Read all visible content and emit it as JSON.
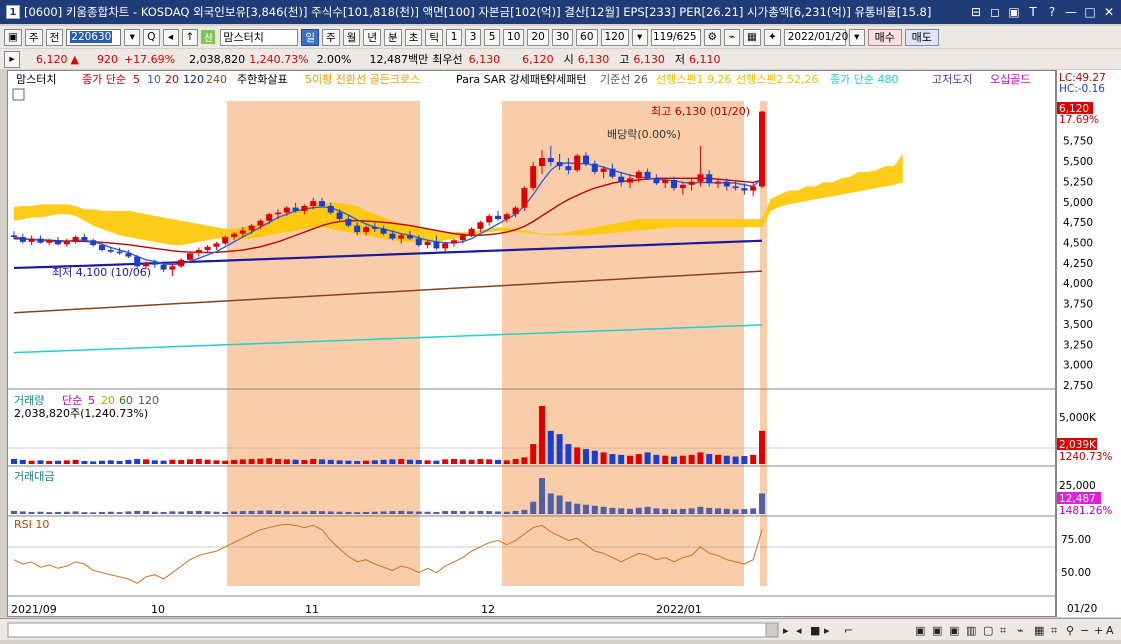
{
  "window": {
    "number": "1",
    "title": "[0600] 키움종합차트 - KOSDAQ 외국인보유[3,846(천)] 주식수[101,818(천)] 액면[100] 자본금[102(억)] 결산[12월] EPS[233] PER[26.21] 시가총액[6,231(억)] 유통비율[15.8]",
    "controls": [
      "⊟",
      "◻",
      "▣",
      "T",
      "?",
      "—",
      "□",
      "✕"
    ]
  },
  "toolbar1": {
    "tab_stock": "주",
    "tab_prev": "전",
    "code": "220630",
    "search_icon": "Q",
    "sound_icon": "◂",
    "indicator_group_num": "신",
    "indicator_name": "맘스터치",
    "periods": [
      "일",
      "주",
      "월",
      "년",
      "분",
      "초",
      "틱"
    ],
    "minutes": [
      "1",
      "3",
      "5",
      "10",
      "20",
      "30",
      "60",
      "120"
    ],
    "counter": "119/625",
    "date": "2022/01/20",
    "buy": "매수",
    "sell": "매도"
  },
  "quote": {
    "price": "6,120",
    "up_arrow": "▲",
    "change": "920",
    "change_pct": "+17.69%",
    "volume": "2,038,820",
    "volume_pct": "1,240.73%",
    "turnover": "2.00%",
    "amount": "12,487백만",
    "best_ask_label": "최우선",
    "best_ask": "6,130",
    "best_bid": "6,120",
    "open_label": "시",
    "open": "6,130",
    "high_label": "고",
    "high": "6,130",
    "low_label": "저",
    "low": "6,110"
  },
  "legend": {
    "name": "맘스터치",
    "ma_label": "종가 단순",
    "ma": [
      "5",
      "10",
      "20",
      "120",
      "240"
    ],
    "signal_label": "주한화살표",
    "pattern1": "5이평 전환선 골든크로스",
    "pattern2": "Para SAR 강세패턴",
    "pattern3": "약세패턴",
    "kijun": "기준선 26",
    "span1": "선행스팬1 9,26",
    "span2": "선행스팬2 52,26",
    "ma480": "종가 단순 480",
    "highlow": "고저도지",
    "goldcross": "오십골드"
  },
  "annotations": {
    "high": "최고 6,130 (01/20)",
    "low": "최저 4,100 (10/06)",
    "dividend": "배당락(0.00%)"
  },
  "price_axis": {
    "labels": [
      "5,750",
      "5,500",
      "5,250",
      "5,000",
      "4,750",
      "4,500",
      "4,250",
      "4,000",
      "3,750",
      "3,500",
      "3,250",
      "3,000",
      "2,750"
    ],
    "lc": "LC:49.27",
    "hc": "HC:-0.16",
    "curr_price": "6,120",
    "curr_pct": "17.69%"
  },
  "volume_panel": {
    "title": "거래량",
    "ma_label": "단순",
    "ma": [
      "5",
      "20",
      "60",
      "120"
    ],
    "info": "2,038,820주(1,240.73%)",
    "axis_label": "5,000K",
    "curr": "2,039K",
    "curr_pct": "1240.73%"
  },
  "amount_panel": {
    "title": "거래대금",
    "axis_label": "25,000",
    "curr": "12,487",
    "curr_pct": "1481.26%"
  },
  "rsi_panel": {
    "title": "RSI 10",
    "labels": [
      "75.00",
      "50.00"
    ]
  },
  "x_axis": {
    "labels": [
      "2021/09",
      "10",
      "11",
      "12",
      "2022/01"
    ],
    "axis_date": "01/20"
  },
  "chart_data": {
    "type": "candlestick",
    "ylim": [
      2750,
      6250
    ],
    "candles": [
      [
        4600,
        4650,
        4550,
        4580
      ],
      [
        4580,
        4620,
        4500,
        4520
      ],
      [
        4520,
        4600,
        4480,
        4560
      ],
      [
        4560,
        4600,
        4500,
        4510
      ],
      [
        4510,
        4560,
        4480,
        4540
      ],
      [
        4540,
        4580,
        4480,
        4490
      ],
      [
        4490,
        4560,
        4460,
        4530
      ],
      [
        4530,
        4600,
        4500,
        4580
      ],
      [
        4580,
        4620,
        4520,
        4540
      ],
      [
        4540,
        4560,
        4460,
        4480
      ],
      [
        4480,
        4520,
        4400,
        4420
      ],
      [
        4420,
        4460,
        4380,
        4400
      ],
      [
        4400,
        4450,
        4360,
        4380
      ],
      [
        4380,
        4420,
        4320,
        4340
      ],
      [
        4340,
        4360,
        4200,
        4220
      ],
      [
        4220,
        4280,
        4180,
        4260
      ],
      [
        4260,
        4300,
        4200,
        4240
      ],
      [
        4240,
        4280,
        4150,
        4180
      ],
      [
        4180,
        4260,
        4100,
        4220
      ],
      [
        4220,
        4320,
        4200,
        4300
      ],
      [
        4300,
        4400,
        4280,
        4380
      ],
      [
        4380,
        4450,
        4340,
        4420
      ],
      [
        4420,
        4480,
        4380,
        4460
      ],
      [
        4460,
        4520,
        4420,
        4500
      ],
      [
        4500,
        4600,
        4480,
        4580
      ],
      [
        4580,
        4640,
        4540,
        4620
      ],
      [
        4620,
        4700,
        4580,
        4660
      ],
      [
        4660,
        4740,
        4620,
        4720
      ],
      [
        4720,
        4800,
        4680,
        4780
      ],
      [
        4780,
        4880,
        4740,
        4860
      ],
      [
        4860,
        4920,
        4800,
        4880
      ],
      [
        4880,
        4960,
        4840,
        4940
      ],
      [
        4940,
        5000,
        4880,
        4900
      ],
      [
        4900,
        4980,
        4860,
        4960
      ],
      [
        4960,
        5060,
        4920,
        5020
      ],
      [
        5020,
        5060,
        4940,
        4960
      ],
      [
        4960,
        5000,
        4860,
        4880
      ],
      [
        4880,
        4920,
        4780,
        4800
      ],
      [
        4800,
        4840,
        4700,
        4720
      ],
      [
        4720,
        4760,
        4600,
        4640
      ],
      [
        4640,
        4720,
        4600,
        4700
      ],
      [
        4700,
        4760,
        4640,
        4680
      ],
      [
        4680,
        4720,
        4600,
        4620
      ],
      [
        4620,
        4660,
        4540,
        4560
      ],
      [
        4560,
        4620,
        4500,
        4600
      ],
      [
        4600,
        4660,
        4540,
        4560
      ],
      [
        4560,
        4600,
        4460,
        4480
      ],
      [
        4480,
        4540,
        4440,
        4520
      ],
      [
        4520,
        4600,
        4420,
        4440
      ],
      [
        4440,
        4520,
        4400,
        4500
      ],
      [
        4500,
        4560,
        4460,
        4540
      ],
      [
        4540,
        4620,
        4500,
        4600
      ],
      [
        4600,
        4700,
        4580,
        4680
      ],
      [
        4680,
        4780,
        4640,
        4760
      ],
      [
        4760,
        4860,
        4720,
        4840
      ],
      [
        4840,
        4900,
        4780,
        4800
      ],
      [
        4800,
        4880,
        4760,
        4860
      ],
      [
        4860,
        4960,
        4820,
        4940
      ],
      [
        4940,
        5200,
        4900,
        5180
      ],
      [
        5180,
        5500,
        5150,
        5450
      ],
      [
        5450,
        5650,
        5350,
        5550
      ],
      [
        5550,
        5700,
        5450,
        5500
      ],
      [
        5500,
        5600,
        5400,
        5450
      ],
      [
        5450,
        5550,
        5350,
        5400
      ],
      [
        5400,
        5600,
        5380,
        5580
      ],
      [
        5580,
        5620,
        5450,
        5480
      ],
      [
        5480,
        5520,
        5350,
        5380
      ],
      [
        5380,
        5450,
        5300,
        5420
      ],
      [
        5420,
        5480,
        5300,
        5320
      ],
      [
        5320,
        5380,
        5200,
        5250
      ],
      [
        5250,
        5350,
        5180,
        5300
      ],
      [
        5300,
        5400,
        5250,
        5380
      ],
      [
        5380,
        5420,
        5280,
        5300
      ],
      [
        5300,
        5350,
        5220,
        5240
      ],
      [
        5240,
        5300,
        5180,
        5280
      ],
      [
        5280,
        5320,
        5150,
        5180
      ],
      [
        5180,
        5260,
        5100,
        5220
      ],
      [
        5220,
        5300,
        5150,
        5260
      ],
      [
        5260,
        5700,
        5200,
        5350
      ],
      [
        5350,
        5400,
        5200,
        5240
      ],
      [
        5240,
        5300,
        5180,
        5260
      ],
      [
        5260,
        5300,
        5150,
        5200
      ],
      [
        5200,
        5260,
        5150,
        5180
      ],
      [
        5180,
        5240,
        5100,
        5150
      ],
      [
        5150,
        5250,
        5080,
        5200
      ],
      [
        5200,
        6130,
        5180,
        6120
      ]
    ],
    "volume": [
      30,
      25,
      20,
      22,
      18,
      20,
      22,
      25,
      18,
      16,
      20,
      22,
      18,
      25,
      30,
      28,
      22,
      20,
      26,
      24,
      28,
      30,
      26,
      22,
      20,
      25,
      28,
      30,
      32,
      35,
      30,
      28,
      26,
      24,
      30,
      28,
      25,
      22,
      20,
      18,
      20,
      22,
      25,
      28,
      30,
      26,
      24,
      22,
      20,
      28,
      30,
      28,
      26,
      30,
      28,
      25,
      22,
      30,
      40,
      120,
      350,
      200,
      180,
      120,
      100,
      90,
      80,
      70,
      60,
      55,
      50,
      60,
      70,
      55,
      50,
      45,
      50,
      55,
      70,
      60,
      55,
      50,
      45,
      48,
      55,
      200
    ],
    "rsi": [
      52,
      48,
      50,
      45,
      47,
      44,
      46,
      50,
      48,
      42,
      40,
      38,
      36,
      34,
      30,
      36,
      38,
      34,
      40,
      46,
      52,
      56,
      58,
      60,
      64,
      68,
      72,
      76,
      80,
      82,
      84,
      85,
      84,
      82,
      84,
      80,
      70,
      62,
      55,
      50,
      52,
      48,
      45,
      42,
      46,
      44,
      40,
      44,
      40,
      46,
      50,
      54,
      60,
      64,
      68,
      70,
      66,
      70,
      76,
      82,
      84,
      78,
      74,
      70,
      72,
      66,
      60,
      58,
      54,
      50,
      54,
      58,
      56,
      52,
      54,
      50,
      54,
      56,
      64,
      58,
      56,
      52,
      50,
      48,
      52,
      80
    ],
    "ma5": [
      4580,
      4560,
      4550,
      4540,
      4530,
      4520,
      4530,
      4540,
      4540,
      4520,
      4490,
      4450,
      4420,
      4390,
      4340,
      4300,
      4280,
      4250,
      4240,
      4250,
      4280,
      4320,
      4360,
      4400,
      4460,
      4520,
      4580,
      4640,
      4700,
      4760,
      4820,
      4860,
      4900,
      4920,
      4940,
      4950,
      4940,
      4900,
      4850,
      4790,
      4740,
      4700,
      4680,
      4650,
      4620,
      4600,
      4570,
      4540,
      4520,
      4510,
      4510,
      4520,
      4560,
      4620,
      4680,
      4740,
      4800,
      4860,
      4960,
      5100,
      5260,
      5400,
      5480,
      5490,
      5480,
      5480,
      5460,
      5440,
      5400,
      5370,
      5340,
      5320,
      5300,
      5290,
      5280,
      5270,
      5250,
      5240,
      5250,
      5250,
      5240,
      5250,
      5240,
      5220,
      5200,
      5300
    ],
    "ma20": [
      4560,
      4555,
      4550,
      4545,
      4540,
      4535,
      4530,
      4528,
      4525,
      4520,
      4515,
      4505,
      4495,
      4485,
      4470,
      4455,
      4440,
      4425,
      4410,
      4400,
      4395,
      4392,
      4390,
      4392,
      4400,
      4410,
      4420,
      4440,
      4460,
      4490,
      4520,
      4560,
      4600,
      4640,
      4680,
      4720,
      4750,
      4770,
      4780,
      4780,
      4775,
      4770,
      4760,
      4750,
      4735,
      4720,
      4700,
      4680,
      4660,
      4640,
      4620,
      4610,
      4600,
      4600,
      4610,
      4620,
      4640,
      4670,
      4710,
      4770,
      4840,
      4910,
      4980,
      5040,
      5090,
      5140,
      5180,
      5210,
      5240,
      5260,
      5270,
      5280,
      5290,
      5300,
      5300,
      5300,
      5300,
      5300,
      5300,
      5300,
      5290,
      5280,
      5270,
      5260,
      5250,
      5280
    ],
    "ma120": [
      4200,
      4203,
      4206,
      4210,
      4213,
      4216,
      4220,
      4223,
      4226,
      4230,
      4234,
      4238,
      4242,
      4246,
      4250,
      4254,
      4258,
      4262,
      4266,
      4270,
      4274,
      4278,
      4282,
      4286,
      4290,
      4294,
      4298,
      4302,
      4306,
      4310,
      4314,
      4318,
      4322,
      4326,
      4330,
      4334,
      4338,
      4342,
      4346,
      4350,
      4354,
      4358,
      4362,
      4366,
      4370,
      4374,
      4378,
      4382,
      4386,
      4390,
      4394,
      4398,
      4402,
      4406,
      4410,
      4414,
      4418,
      4422,
      4426,
      4430,
      4434,
      4438,
      4442,
      4446,
      4450,
      4454,
      4458,
      4462,
      4466,
      4470,
      4474,
      4478,
      4482,
      4486,
      4490,
      4494,
      4498,
      4502,
      4506,
      4510,
      4514,
      4518,
      4522,
      4526,
      4530,
      4534
    ],
    "ma240": [
      3650,
      3656,
      3662,
      3668,
      3674,
      3680,
      3686,
      3692,
      3698,
      3704,
      3710,
      3716,
      3722,
      3728,
      3734,
      3740,
      3746,
      3752,
      3758,
      3764,
      3770,
      3776,
      3782,
      3788,
      3794,
      3800,
      3806,
      3812,
      3818,
      3824,
      3830,
      3836,
      3842,
      3848,
      3854,
      3860,
      3866,
      3872,
      3878,
      3884,
      3890,
      3896,
      3902,
      3908,
      3914,
      3920,
      3926,
      3932,
      3938,
      3944,
      3950,
      3956,
      3962,
      3968,
      3974,
      3980,
      3986,
      3992,
      3998,
      4004,
      4010,
      4016,
      4022,
      4028,
      4034,
      4040,
      4046,
      4052,
      4058,
      4064,
      4070,
      4076,
      4082,
      4088,
      4094,
      4100,
      4106,
      4112,
      4118,
      4124,
      4130,
      4136,
      4142,
      4148,
      4154,
      4160
    ],
    "ma480": [
      3160,
      3164,
      3168,
      3172,
      3176,
      3180,
      3184,
      3188,
      3192,
      3196,
      3200,
      3204,
      3208,
      3212,
      3216,
      3220,
      3224,
      3228,
      3232,
      3236,
      3240,
      3244,
      3248,
      3252,
      3256,
      3260,
      3264,
      3268,
      3272,
      3276,
      3280,
      3284,
      3288,
      3292,
      3296,
      3300,
      3304,
      3308,
      3312,
      3316,
      3320,
      3324,
      3328,
      3332,
      3336,
      3340,
      3344,
      3348,
      3352,
      3356,
      3360,
      3364,
      3368,
      3372,
      3376,
      3380,
      3384,
      3388,
      3392,
      3396,
      3400,
      3404,
      3408,
      3412,
      3416,
      3420,
      3424,
      3428,
      3432,
      3436,
      3440,
      3444,
      3448,
      3452,
      3456,
      3460,
      3464,
      3468,
      3472,
      3476,
      3480,
      3484,
      3488,
      3492,
      3496,
      3500
    ],
    "cloud_upper": [
      4950,
      4960,
      4960,
      4980,
      4980,
      4980,
      4980,
      4960,
      4920,
      4920,
      4900,
      4900,
      4900,
      4900,
      4880,
      4860,
      4840,
      4820,
      4800,
      4780,
      4760,
      4740,
      4720,
      4700,
      4680,
      4680,
      4700,
      4720,
      4740,
      4760,
      4800,
      4860,
      4900,
      4940,
      4980,
      5000,
      5000,
      5000,
      4980,
      4960,
      4900,
      4860,
      4820,
      4780,
      4740,
      4720,
      4700,
      4680,
      4660,
      4640,
      4640,
      4640,
      4640,
      4660,
      4680,
      4700,
      4700,
      4680,
      4660,
      4640,
      4620,
      4620,
      4620,
      4640,
      4660,
      4680,
      4700,
      4720,
      4740,
      4760,
      4780,
      4800,
      4800,
      4800,
      4800,
      4800,
      4800,
      4800,
      4800,
      4800,
      4800,
      4800,
      4800,
      4800,
      4800,
      4800,
      5050,
      5100,
      5150,
      5150,
      5200,
      5200,
      5250,
      5250,
      5300,
      5320,
      5380,
      5380,
      5400,
      5450,
      5450,
      5600
    ],
    "cloud_lower": [
      4780,
      4800,
      4820,
      4820,
      4840,
      4860,
      4860,
      4840,
      4780,
      4720,
      4680,
      4640,
      4600,
      4580,
      4560,
      4540,
      4520,
      4500,
      4480,
      4480,
      4500,
      4520,
      4540,
      4560,
      4560,
      4560,
      4560,
      4560,
      4580,
      4600,
      4620,
      4640,
      4660,
      4680,
      4700,
      4700,
      4680,
      4660,
      4640,
      4620,
      4600,
      4580,
      4560,
      4540,
      4520,
      4520,
      4520,
      4520,
      4520,
      4540,
      4560,
      4580,
      4600,
      4620,
      4640,
      4650,
      4650,
      4640,
      4630,
      4620,
      4610,
      4600,
      4600,
      4600,
      4600,
      4600,
      4610,
      4620,
      4630,
      4640,
      4650,
      4660,
      4670,
      4680,
      4690,
      4700,
      4700,
      4700,
      4700,
      4700,
      4700,
      4700,
      4700,
      4700,
      4700,
      4700,
      4900,
      4950,
      4980,
      5000,
      5020,
      5040,
      5060,
      5080,
      5100,
      5120,
      5140,
      5160,
      5180,
      5200,
      5220,
      5250
    ]
  },
  "colors": {
    "shade": "#f8c49a",
    "cloud": "#ffc800",
    "up": "#e00000",
    "down": "#1a3fd0",
    "ma5": "#e00000",
    "ma10": "#3060e0",
    "ma20": "#c00000",
    "ma120": "#1a1aa0",
    "ma240": "#8a4020",
    "ma480": "#20d0d0"
  }
}
